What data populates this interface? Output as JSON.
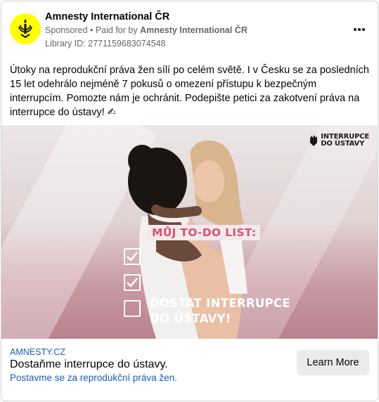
{
  "advertiser": {
    "name": "Amnesty International ČR",
    "sponsored_label": "Sponsored",
    "separator": "•",
    "paid_for_label": "Paid for by",
    "paid_for_name": "Amnesty International ČR",
    "library_id": "Library ID: 2771159683074548",
    "avatar_color": "#ffff00",
    "avatar_icon": "candle-icon"
  },
  "post": {
    "text": "Útoky na reprodukční práva žen sílí po celém světě. I v Česku se za posledních 15 let odehrálo nejméně 7 pokusů o omezení přístupu k bezpečným interrupcím. Pomozte nám je ochránit. Podepište petici za zakotvení práva na interrupce do ústavy! ✍"
  },
  "creative": {
    "brand_line1": "INTERRUPCE",
    "brand_line2": "DO ÚSTAVY",
    "todo_title": "MŮJ TO-DO LIST:",
    "todo_text_line1": "DOSTAT INTERRUPCE",
    "todo_text_line2": "DO ÚSTAVY!",
    "title_color": "#d0557a"
  },
  "link": {
    "domain": "AMNESTY.CZ",
    "headline": "Dostaňme interrupce do ústavy.",
    "description": "Postavme se za reprodukční práva žen.",
    "cta_label": "Learn More",
    "link_color": "#1a5fb4"
  }
}
